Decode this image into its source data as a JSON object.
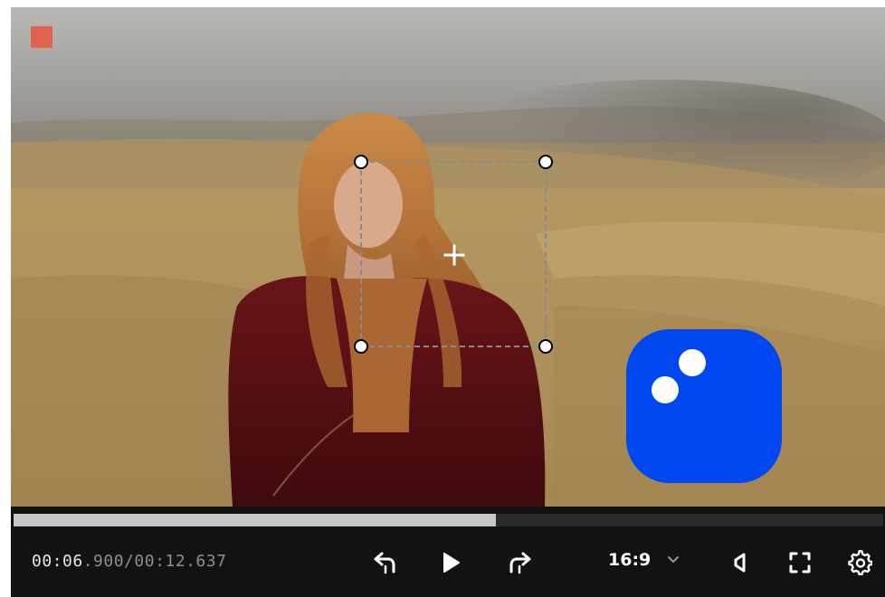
{
  "player": {
    "time_current": "00:06",
    "time_current_ms": ".900",
    "time_separator": "/",
    "time_total": "00:12.637",
    "progress": 0.555,
    "aspect_ratio": "16:9"
  },
  "icons": {
    "record": "record-indicator",
    "rewind": "rewind-back-icon",
    "play": "play-icon",
    "forward": "skip-forward-icon",
    "ratio_dropdown": "chevron-down-icon",
    "volume": "speaker-icon",
    "fullscreen": "fullscreen-icon",
    "settings": "gear-icon",
    "crop_move": "crosshair-plus-icon",
    "app": "app-bubble-icon"
  },
  "colors": {
    "record": "#e0634f",
    "app_bubble": "#0047f0",
    "progress_fill": "#c7c7c7",
    "progress_track": "#2b2b2b",
    "controls_bg": "#121212"
  }
}
